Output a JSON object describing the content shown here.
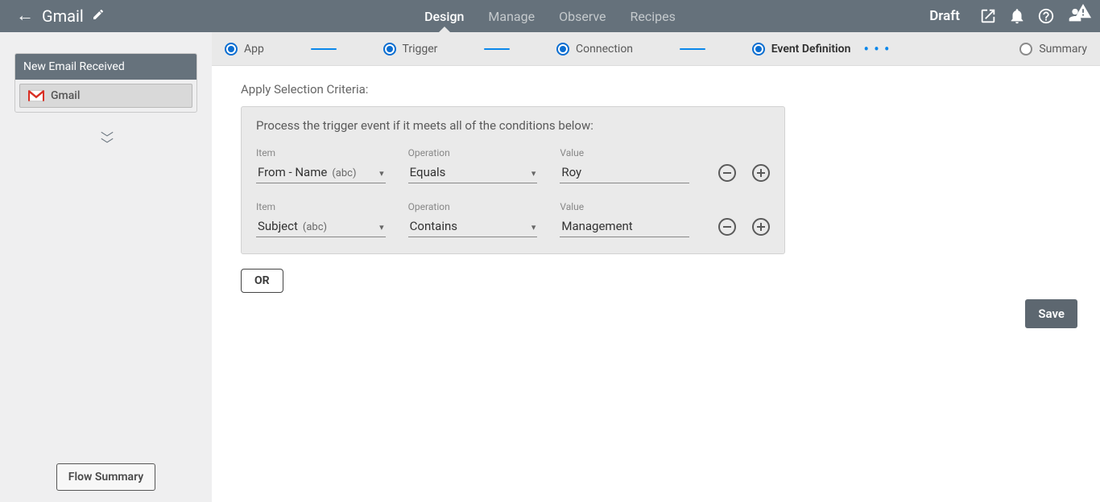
{
  "header": {
    "title": "Gmail",
    "tabs": {
      "design": "Design",
      "manage": "Manage",
      "observe": "Observe",
      "recipes": "Recipes"
    },
    "status": "Draft"
  },
  "sidebar": {
    "trigger_header": "New Email Received",
    "trigger_app": "Gmail",
    "flow_summary_label": "Flow Summary"
  },
  "stepper": {
    "app": "App",
    "trigger": "Trigger",
    "connection": "Connection",
    "event_def": "Event Definition",
    "summary": "Summary"
  },
  "content": {
    "section_label": "Apply Selection Criteria:",
    "box_desc": "Process the trigger event if it meets all of the conditions below:",
    "labels": {
      "item": "Item",
      "operation": "Operation",
      "value": "Value"
    },
    "rows": [
      {
        "item": "From - Name",
        "item_type": "(abc)",
        "operation": "Equals",
        "value": "Roy"
      },
      {
        "item": "Subject",
        "item_type": "(abc)",
        "operation": "Contains",
        "value": "Management"
      }
    ],
    "or_label": "OR",
    "save_label": "Save"
  }
}
